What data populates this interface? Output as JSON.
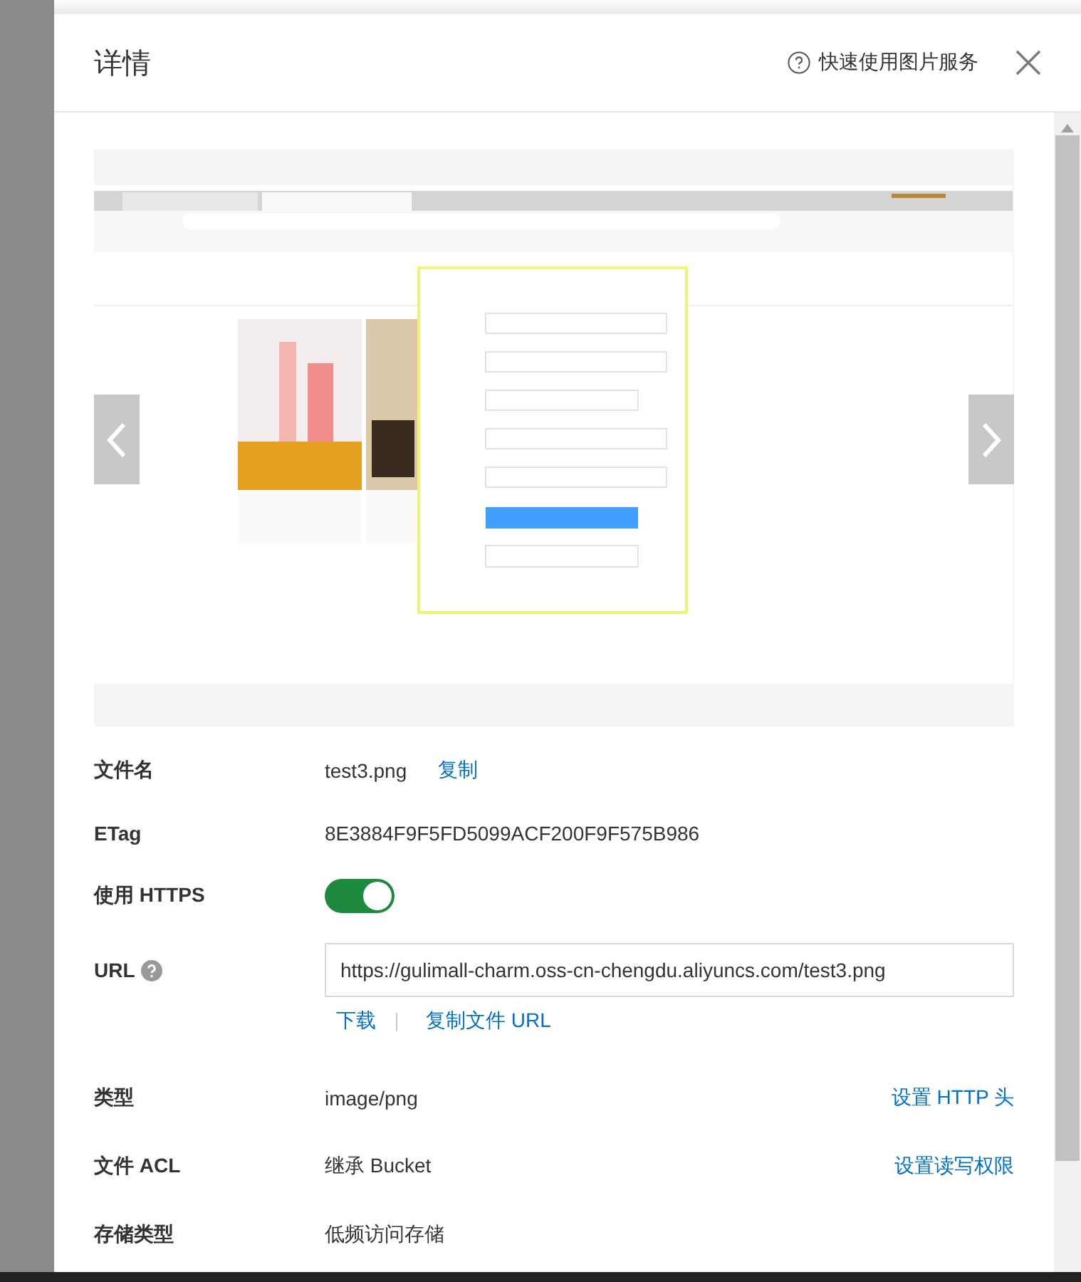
{
  "header": {
    "title": "详情",
    "help_link": "快速使用图片服务"
  },
  "details": [
    {
      "kind": "text",
      "label": "文件名",
      "value": "test3.png",
      "action": "复制"
    },
    {
      "kind": "text",
      "label": "ETag",
      "value": "8E3884F9F5FD5099ACF200F9F575B986"
    },
    {
      "kind": "toggle",
      "label": "使用 HTTPS",
      "on": true
    },
    {
      "kind": "url",
      "label": "URL",
      "value": "https://gulimall-charm.oss-cn-chengdu.aliyuncs.com/test3.png",
      "links": [
        "下载",
        "复制文件 URL"
      ]
    },
    {
      "kind": "text",
      "label": "类型",
      "value": "image/png",
      "right_action": "设置 HTTP 头"
    },
    {
      "kind": "text",
      "label": "文件 ACL",
      "value": "继承 Bucket",
      "right_action": "设置读写权限"
    },
    {
      "kind": "text",
      "label": "存储类型",
      "value": "低频访问存储"
    }
  ]
}
